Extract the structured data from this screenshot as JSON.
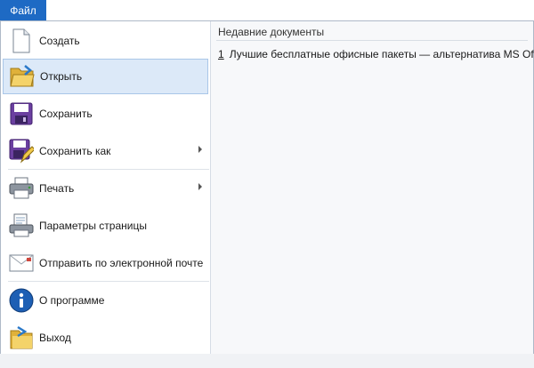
{
  "tab": {
    "label": "Файл"
  },
  "menu": {
    "items": [
      {
        "label": "Создать",
        "icon": "new-document-icon",
        "submenu": false,
        "selected": false
      },
      {
        "label": "Открыть",
        "icon": "open-folder-icon",
        "submenu": false,
        "selected": true
      },
      {
        "label": "Сохранить",
        "icon": "save-disk-icon",
        "submenu": false,
        "selected": false
      },
      {
        "label": "Сохранить как",
        "icon": "save-as-icon",
        "submenu": true,
        "selected": false
      },
      {
        "label": "Печать",
        "icon": "printer-icon",
        "submenu": true,
        "selected": false
      },
      {
        "label": "Параметры страницы",
        "icon": "page-setup-icon",
        "submenu": false,
        "selected": false
      },
      {
        "label": "Отправить по электронной почте",
        "icon": "email-icon",
        "submenu": false,
        "selected": false
      },
      {
        "label": "О программе",
        "icon": "info-icon",
        "submenu": false,
        "selected": false
      },
      {
        "label": "Выход",
        "icon": "exit-icon",
        "submenu": false,
        "selected": false
      }
    ]
  },
  "recent": {
    "title": "Недавние документы",
    "items": [
      {
        "number": "1",
        "label": "Лучшие бесплатные офисные пакеты — альтернатива MS Office"
      }
    ]
  },
  "colors": {
    "accent": "#1e6ac4",
    "selected_bg": "#dce9f8",
    "selected_border": "#a9c6e8",
    "panel_bg": "#f7f8fa"
  }
}
